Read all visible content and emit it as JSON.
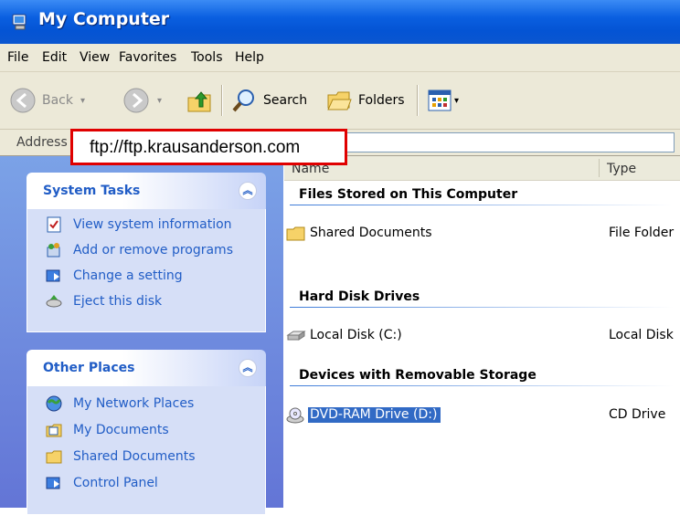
{
  "window": {
    "title": "My Computer"
  },
  "menu": [
    "File",
    "Edit",
    "View",
    "Favorites",
    "Tools",
    "Help"
  ],
  "toolbar": {
    "back": "Back",
    "search": "Search",
    "folders": "Folders"
  },
  "address": {
    "label": "Address",
    "url": "ftp://ftp.krausanderson.com"
  },
  "sidebar": {
    "system_tasks": {
      "title": "System Tasks",
      "items": [
        "View system information",
        "Add or remove programs",
        "Change a setting",
        "Eject this disk"
      ]
    },
    "other_places": {
      "title": "Other Places",
      "items": [
        "My Network Places",
        "My Documents",
        "Shared Documents",
        "Control Panel"
      ]
    }
  },
  "content": {
    "columns": {
      "name": "Name",
      "type": "Type"
    },
    "groups": [
      {
        "title": "Files Stored on This Computer",
        "items": [
          {
            "name": "Shared Documents",
            "type": "File Folder"
          }
        ]
      },
      {
        "title": "Hard Disk Drives",
        "items": [
          {
            "name": "Local Disk (C:)",
            "type": "Local Disk"
          }
        ]
      },
      {
        "title": "Devices with Removable Storage",
        "items": [
          {
            "name": "DVD-RAM Drive (D:)",
            "type": "CD Drive"
          }
        ]
      }
    ]
  },
  "colors": {
    "title_blue": "#0454d4",
    "sidebar_blue": "#7ba2e7",
    "link_blue": "#215dc6",
    "selection": "#316ac5",
    "callout_red": "#e00000"
  }
}
